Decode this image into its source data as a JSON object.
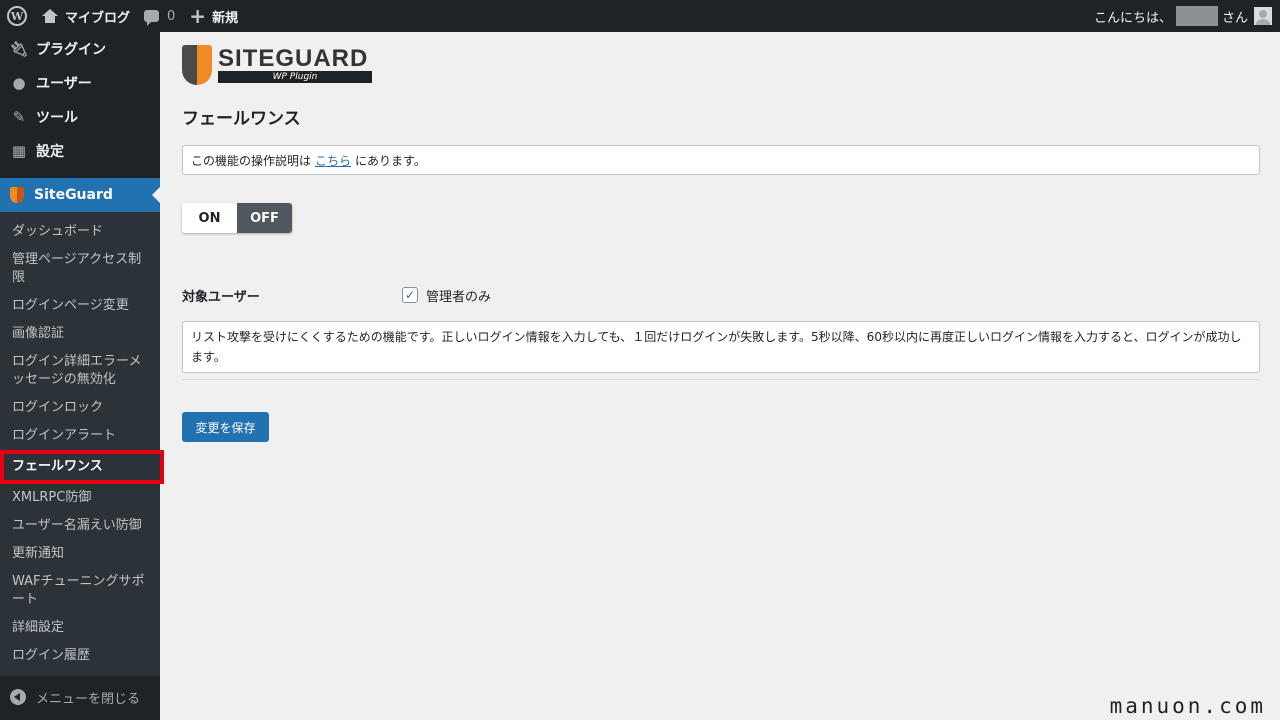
{
  "adminbar": {
    "site_name": "マイブログ",
    "comments_count": "0",
    "new_label": "新規",
    "greeting": "こんにちは、",
    "greeting_suffix": "さん"
  },
  "sidebar": {
    "top_items": [
      {
        "label": "プラグイン",
        "icon": "plugin-icon"
      },
      {
        "label": "ユーザー",
        "icon": "user-icon"
      },
      {
        "label": "ツール",
        "icon": "wrench-icon"
      },
      {
        "label": "設定",
        "icon": "settings-icon"
      }
    ],
    "siteguard_label": "SiteGuard",
    "submenu": [
      "ダッシュボード",
      "管理ページアクセス制限",
      "ログインページ変更",
      "画像認証",
      "ログイン詳細エラーメッセージの無効化",
      "ログインロック",
      "ログインアラート",
      "フェールワンス",
      "XMLRPC防御",
      "ユーザー名漏えい防御",
      "更新通知",
      "WAFチューニングサポート",
      "詳細設定",
      "ログイン履歴"
    ],
    "collapse_label": "メニューを閉じる"
  },
  "logo": {
    "main": "SITEGUARD",
    "sub": "WP Plugin"
  },
  "main": {
    "title": "フェールワンス",
    "notice_prefix": "この機能の操作説明は",
    "notice_link": "こちら",
    "notice_suffix": "にあります。",
    "toggle_on": "ON",
    "toggle_off": "OFF",
    "target_label": "対象ユーザー",
    "admin_only_label": "管理者のみ",
    "description": "リスト攻撃を受けにくくするための機能です。正しいログイン情報を入力しても、１回だけログインが失敗します。5秒以降、60秒以内に再度正しいログイン情報を入力すると、ログインが成功します。",
    "save_label": "変更を保存"
  },
  "watermark": "manuon.com",
  "colors": {
    "accent": "#2271b1",
    "highlight": "#e60012",
    "sidebar_bg": "#1d2327"
  }
}
